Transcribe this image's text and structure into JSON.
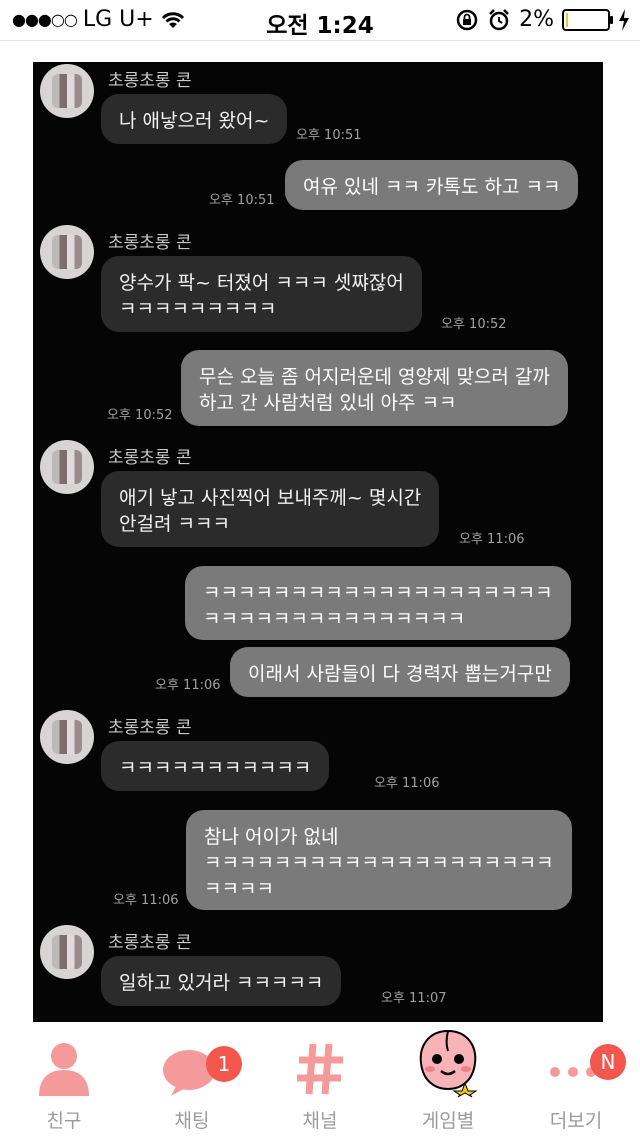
{
  "status_bar": {
    "carrier": "LG U+",
    "time": "오전 1:24",
    "battery": "2%",
    "battery_level": 0.02
  },
  "chat": {
    "sender_name": "초롱초롱 콘",
    "messages": [
      {
        "dir": "in",
        "text": "나 애낳으러 왔어~",
        "time": "오후 10:51"
      },
      {
        "dir": "out",
        "text": "여유 있네 ㅋㅋ 카톡도 하고 ㅋㅋ",
        "time": "오후 10:51"
      },
      {
        "dir": "in",
        "text": "양수가 팍~ 터졌어 ㅋㅋㅋ 셋쨔잖어\nㅋㅋㅋㅋㅋㅋㅋㅋㅋ",
        "time": "오후 10:52"
      },
      {
        "dir": "out",
        "text": "무슨 오늘 좀 어지러운데 영양제 맞으러 갈까\n하고 간 사람처럼 있네 아주 ㅋㅋ",
        "time": "오후 10:52"
      },
      {
        "dir": "in",
        "text": "애기 낳고 사진찍어 보내주께~ 몇시간\n안걸려 ㅋㅋㅋ",
        "time": "오후 11:06"
      },
      {
        "dir": "out",
        "text": "ㅋㅋㅋㅋㅋㅋㅋㅋㅋㅋㅋㅋㅋㅋㅋㅋㅋㅋㅋㅋ\nㅋㅋㅋㅋㅋㅋㅋㅋㅋㅋㅋㅋㅋㅋㅋ",
        "time": ""
      },
      {
        "dir": "out",
        "text": "이래서 사람들이 다 경력자 뽑는거구만",
        "time": "오후 11:06"
      },
      {
        "dir": "in",
        "text": "ㅋㅋㅋㅋㅋㅋㅋㅋㅋㅋㅋ",
        "time": "오후 11:06"
      },
      {
        "dir": "out",
        "text": "참나 어이가 없네\nㅋㅋㅋㅋㅋㅋㅋㅋㅋㅋㅋㅋㅋㅋㅋㅋㅋㅋㅋㅋ\nㅋㅋㅋㅋ",
        "time": "오후 11:06"
      },
      {
        "dir": "in",
        "text": "일하고 있거라 ㅋㅋㅋㅋㅋ",
        "time": "오후 11:07"
      }
    ]
  },
  "tab_bar": {
    "tabs": [
      {
        "label": "친구",
        "icon": "person-icon"
      },
      {
        "label": "채팅",
        "icon": "chat-bubble-icon",
        "badge": "1"
      },
      {
        "label": "채널",
        "icon": "hashtag-icon"
      },
      {
        "label": "게임별",
        "icon": "apeach-character-icon"
      },
      {
        "label": "더보기",
        "icon": "more-dots-icon",
        "badge": "N"
      }
    ],
    "accent_color": "#f59a9a",
    "badge_color": "#f2564d"
  }
}
